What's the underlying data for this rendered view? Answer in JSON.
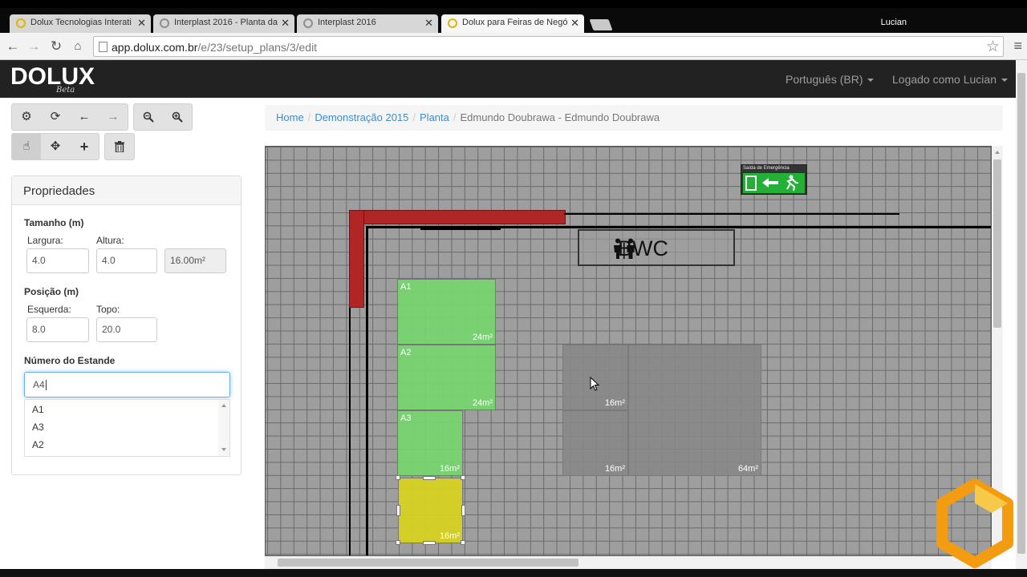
{
  "browser": {
    "tabs": [
      {
        "title": "Dolux Tecnologias Interati"
      },
      {
        "title": "Interplast 2016 - Planta da"
      },
      {
        "title": "Interplast 2016"
      },
      {
        "title": "Dolux para Feiras de Negó"
      }
    ],
    "profile": "Lucian",
    "url_host": "app.dolux.com.br",
    "url_path": "/e/23/setup_plans/3/edit"
  },
  "navbar": {
    "logo": "DOLUX",
    "logo_sub": "Beta",
    "language": "Português (BR)",
    "user": "Logado como Lucian"
  },
  "toolbar_icons": [
    "gear-icon",
    "refresh-icon",
    "arrow-left-icon",
    "arrow-right-icon",
    "zoom-out-icon",
    "zoom-in-icon",
    "hand-pointer-icon",
    "move-icon",
    "plus-icon",
    "trash-icon"
  ],
  "properties": {
    "heading": "Propriedades",
    "size_label": "Tamanho (m)",
    "width_label": "Largura:",
    "height_label": "Altura:",
    "width": "4.0",
    "height": "4.0",
    "area": "16.00m²",
    "position_label": "Posição (m)",
    "left_label": "Esquerda:",
    "top_label": "Topo:",
    "left": "8.0",
    "top": "20.0",
    "stand_label": "Número do Estande",
    "stand_value": "A4",
    "stand_options": [
      "A1",
      "A3",
      "A2"
    ]
  },
  "breadcrumb": {
    "home": "Home",
    "event": "Demonstração 2015",
    "plan": "Planta",
    "current": "Edmundo Doubrawa - Edmundo Doubrawa"
  },
  "plan": {
    "bwc_label": "BWC",
    "exit_label": "Saída de Emergência",
    "booths": [
      {
        "label": "A1",
        "area": "24m²",
        "color": "#76d66e"
      },
      {
        "label": "A2",
        "area": "24m²",
        "color": "#76d66e"
      },
      {
        "label": "A3",
        "area": "16m²",
        "color": "#76d66e"
      },
      {
        "label": "",
        "area": "16m²",
        "color": "#d6d222"
      },
      {
        "label": "",
        "area": "16m²",
        "color": "#878787"
      },
      {
        "label": "",
        "area": "16m²",
        "color": "#878787"
      },
      {
        "label": "",
        "area": "64m²",
        "color": "#878787"
      }
    ]
  }
}
